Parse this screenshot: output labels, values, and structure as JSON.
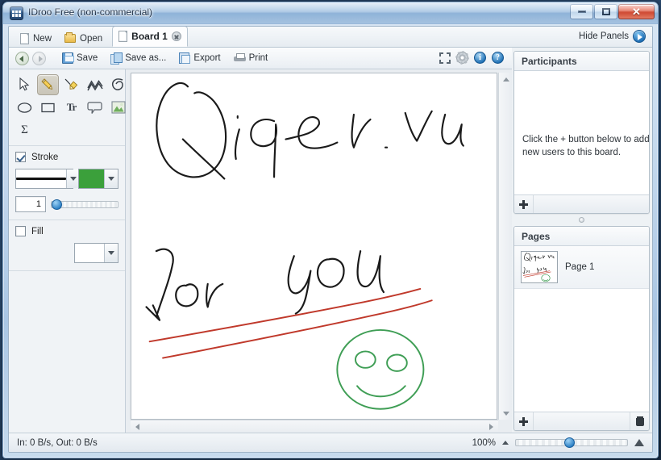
{
  "window": {
    "title": "IDroo Free (non-commercial)",
    "app_icon": "idroo-app-icon",
    "minimize_label": "–",
    "maximize_label": "□",
    "close_label": "✕"
  },
  "tabbar": {
    "new_label": "New",
    "open_label": "Open",
    "board_tab_label": "Board 1",
    "hide_panels_label": "Hide Panels"
  },
  "toolbar": {
    "back_label": "",
    "forward_label": "",
    "save_label": "Save",
    "save_as_label": "Save as...",
    "export_label": "Export",
    "print_label": "Print",
    "fullscreen_icon": "fullscreen-icon",
    "settings_icon": "gear-icon",
    "info_label": "i",
    "help_label": "?"
  },
  "tools": [
    {
      "name": "select-tool",
      "glyph": "cursor",
      "selected": false
    },
    {
      "name": "pencil-tool",
      "glyph": "pencil",
      "selected": true
    },
    {
      "name": "highlighter-tool",
      "glyph": "highlighter",
      "selected": false
    },
    {
      "name": "polyline-tool",
      "glyph": "polyline",
      "selected": false
    },
    {
      "name": "curve-tool",
      "glyph": "curve",
      "selected": false
    },
    {
      "name": "ellipse-tool",
      "glyph": "ellipse",
      "selected": false
    },
    {
      "name": "rectangle-tool",
      "glyph": "rectangle",
      "selected": false
    },
    {
      "name": "text-tool",
      "glyph": "Tr",
      "selected": false
    },
    {
      "name": "callout-tool",
      "glyph": "callout",
      "selected": false
    },
    {
      "name": "image-tool",
      "glyph": "image",
      "selected": false
    },
    {
      "name": "formula-tool",
      "glyph": "Σ",
      "selected": false
    }
  ],
  "stroke": {
    "label": "Stroke",
    "enabled": true,
    "color": "#3ba03b",
    "line_color": "#111111",
    "width_value": "1"
  },
  "fill": {
    "label": "Fill",
    "enabled": false,
    "color": "#ffffff"
  },
  "canvas": {
    "ink_black": "#1a1a1a",
    "ink_red": "#c0392b",
    "ink_green": "#3f9e55",
    "handwriting_top": "Qiqev ru",
    "handwriting_bottom": "for you",
    "shapes": "two red lines and a green smiley face"
  },
  "participants": {
    "title": "Participants",
    "empty_message": "Click the + button below to add new users to this board.",
    "add_label": "+"
  },
  "pages": {
    "title": "Pages",
    "items": [
      {
        "label": "Page 1",
        "selected": true
      }
    ],
    "add_label": "+",
    "delete_label": "delete"
  },
  "status": {
    "network": "In: 0 B/s, Out: 0 B/s",
    "zoom_level": "100%"
  }
}
